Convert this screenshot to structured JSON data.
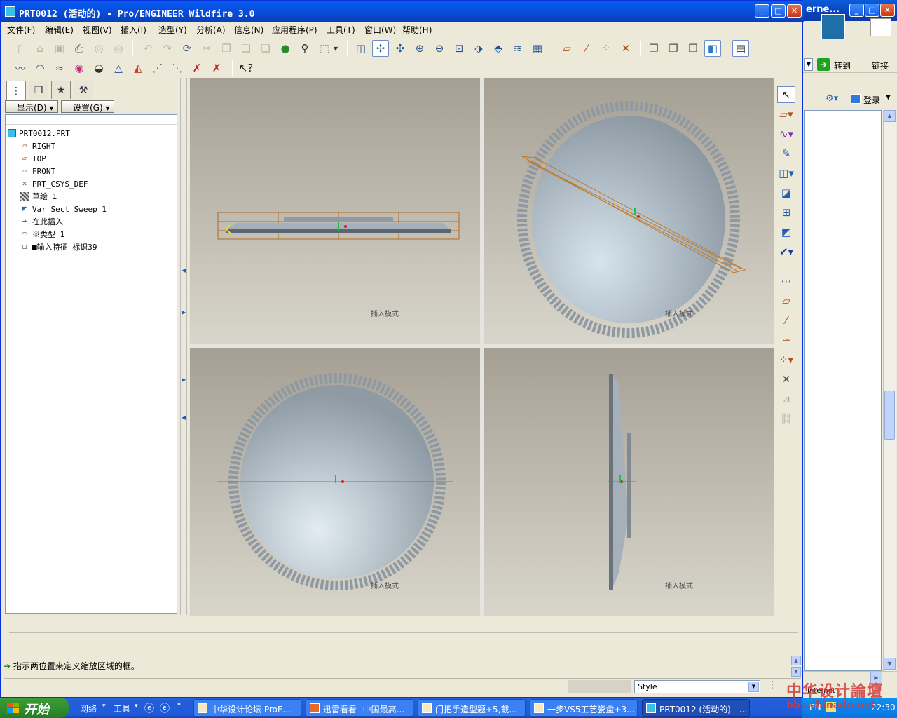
{
  "main_window": {
    "title": "PRT0012 (活动的) - Pro/ENGINEER Wildfire 3.0",
    "buttons": [
      "_",
      "□",
      "X"
    ]
  },
  "menu": [
    "文件(F)",
    "编辑(E)",
    "视图(V)",
    "插入(I)",
    "造型(Y)",
    "分析(A)",
    "信息(N)",
    "应用程序(P)",
    "工具(T)",
    "窗口(W)",
    "帮助(H)"
  ],
  "toolbar_icons": {
    "row1": [
      "new-file-icon",
      "open-icon",
      "save-icon",
      "print-icon",
      "send-icon",
      "email-icon",
      "undo-icon",
      "redo-icon",
      "regenerate-icon",
      "cut-icon",
      "copy-icon",
      "paste-icon",
      "paste-special-icon",
      "color-icon",
      "search-icon",
      "selection-box-icon",
      "repaint-icon",
      "spin-center-icon",
      "orient-icon",
      "zoom-in-icon",
      "zoom-out-icon",
      "refit-icon",
      "reorient-icon",
      "saved-views-icon",
      "layers-icon",
      "view-manager-icon",
      "datum-plane-display-icon",
      "datum-axis-display-icon",
      "point-display-icon",
      "csys-display-icon",
      "wireframe-icon",
      "hidden-line-icon",
      "no-hidden-icon",
      "shading-icon",
      "model-tree-toggle-icon"
    ],
    "row2": [
      "style-curve-icon",
      "style-surface-icon",
      "curvature-icon",
      "section-analysis-icon",
      "reflection-icon",
      "draft-icon",
      "slope-icon",
      "offset-icon",
      "delete-analysis-icon",
      "hide-analysis-icon",
      "context-help-icon"
    ]
  },
  "navigator": {
    "tabs": [
      "model-tree-tab",
      "layers-tab",
      "favorites-tab",
      "connections-tab"
    ],
    "display_label": "显示(D)",
    "settings_label": "设置(G)",
    "tree": [
      {
        "label": "PRT0012.PRT",
        "icon": "part-icon"
      },
      {
        "label": "RIGHT",
        "icon": "datum-plane-icon"
      },
      {
        "label": "TOP",
        "icon": "datum-plane-icon"
      },
      {
        "label": "FRONT",
        "icon": "datum-plane-icon"
      },
      {
        "label": "PRT_CSYS_DEF",
        "icon": "csys-icon"
      },
      {
        "label": "草绘 1",
        "icon": "sketch-icon"
      },
      {
        "label": "Var Sect Sweep 1",
        "icon": "sweep-icon"
      },
      {
        "label": "在此插入",
        "icon": "insert-arrow-icon"
      },
      {
        "label": "※类型 1",
        "icon": "style-feature-icon"
      },
      {
        "label": "■输入特征 标识39",
        "icon": "import-feature-icon"
      }
    ]
  },
  "viewport": {
    "pane_label": "插入模式"
  },
  "message": {
    "text": "指示两位置来定义缩放区域的框。"
  },
  "statusbar": {
    "style_value": "Style"
  },
  "background_window": {
    "title": "erne...",
    "goto_label": "转到",
    "links_label": "链接",
    "login_label": "登录",
    "internet_label": "Internet"
  },
  "taskbar": {
    "start_label": "开始",
    "quick": [
      "网络",
      "工具"
    ],
    "tasks": [
      "中华设计论坛 ProE...",
      "迅雷看看--中国最高...",
      "门把手造型题+5,截...",
      "一步VS5工艺瓷盘+3...",
      "PRT0012 (活动的) - ..."
    ],
    "tray_lang": "EN",
    "clock": "22:30"
  },
  "watermark": {
    "line1": "中华设计論壇",
    "line2": "bbs.chinade.net"
  },
  "colors": {
    "title_blue": "#0a4ad4",
    "taskbar_blue": "#245edb",
    "start_green": "#2f8c2f",
    "datum_orange": "#c87a2a"
  }
}
